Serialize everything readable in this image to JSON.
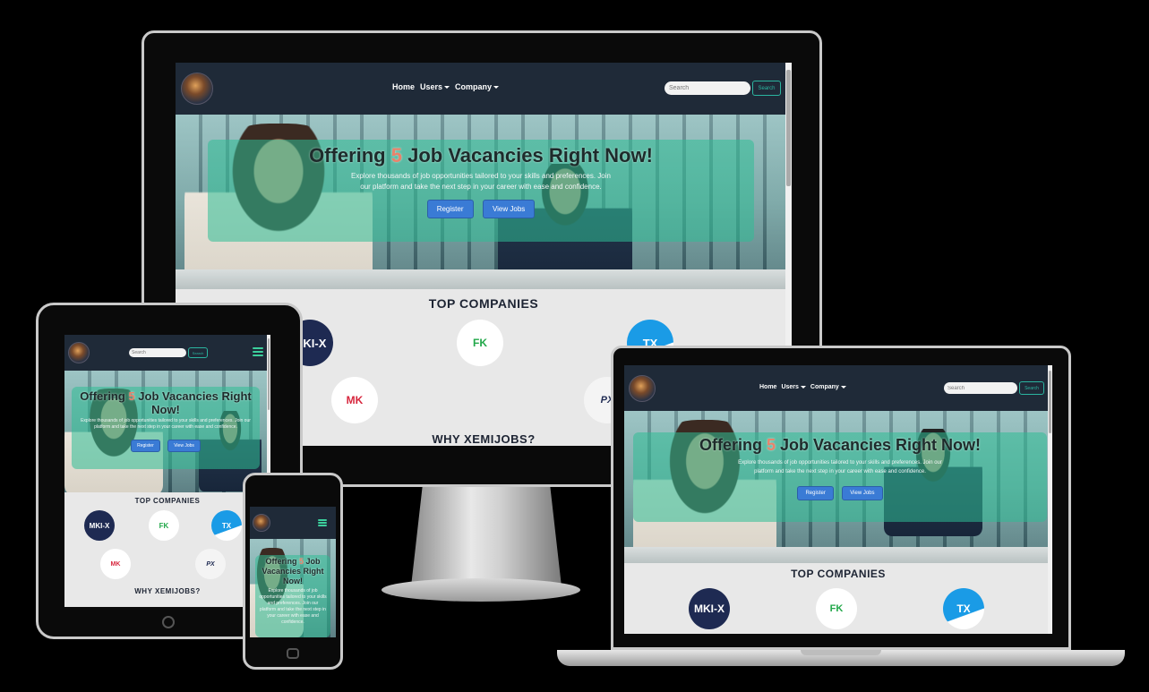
{
  "site": {
    "nav": {
      "home": "Home",
      "users": "Users",
      "company": "Company"
    },
    "search": {
      "placeholder": "Search",
      "button": "Search"
    },
    "hero": {
      "headline_pre": "Offering ",
      "headline_num": "5",
      "headline_post": " Job Vacancies Right Now!",
      "subtext": "Explore thousands of job opportunities tailored to your skills and preferences. Join our platform and take the next step in your career with ease and confidence.",
      "register": "Register",
      "view_jobs": "View Jobs"
    },
    "top_companies": "TOP COMPANIES",
    "why": "WHY XEMIJOBS?",
    "companies": [
      {
        "name": "MKIX",
        "label": "MKI-X"
      },
      {
        "name": "FK",
        "label": "FK"
      },
      {
        "name": "TX",
        "label": "TX"
      },
      {
        "name": "MK",
        "label": "MK"
      },
      {
        "name": "PX",
        "label": "PX"
      }
    ]
  },
  "colors": {
    "navbar": "#1f2a38",
    "accent_teal": "#2bb5a0",
    "hero_overlay": "#30be96",
    "button_blue": "#3a7bd5",
    "highlight_number": "#e9836b",
    "page_bg": "#000000"
  }
}
